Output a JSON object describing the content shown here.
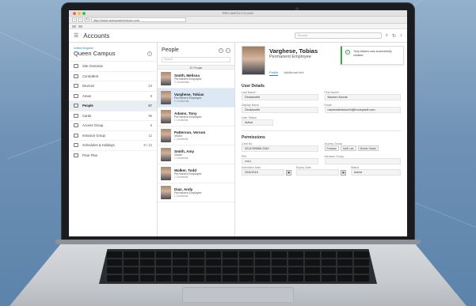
{
  "browser": {
    "window_title": "PRO-WATCH CLOUD",
    "url": "http://www.averywatchcloud.com",
    "back": "<",
    "forward": ">",
    "reload": "↻",
    "traffic": {
      "close": "#ff5f57",
      "minimize": "#febc2e",
      "maximize": "#28c840"
    }
  },
  "header": {
    "menu_icon": "hamburger-icon",
    "title": "Accounts",
    "search_placeholder": "Search",
    "search_icon": "search-icon",
    "refresh_icon": "refresh-icon",
    "notification_icon": "bell-icon"
  },
  "sidebar": {
    "site_label": "United Kingdom",
    "site_name": "Queen Campus",
    "items": [
      {
        "label": "Site Overview",
        "count": "",
        "icon": "grid-icon"
      },
      {
        "label": "Controllers",
        "count": "",
        "icon": "controller-icon"
      },
      {
        "label": "Devices",
        "count": "23",
        "icon": "device-icon"
      },
      {
        "label": "Areas",
        "count": "9",
        "icon": "area-icon"
      },
      {
        "label": "People",
        "count": "67",
        "icon": "people-icon",
        "active": true
      },
      {
        "label": "Cards",
        "count": "96",
        "icon": "card-icon"
      },
      {
        "label": "Access Group",
        "count": "8",
        "icon": "access-group-icon"
      },
      {
        "label": "Intrusion Group",
        "count": "12",
        "icon": "shield-icon"
      },
      {
        "label": "Schedules & Holidays",
        "count": "8 / 12",
        "icon": "calendar-icon"
      },
      {
        "label": "Floor Plan",
        "count": "",
        "icon": "floorplan-icon"
      }
    ]
  },
  "people": {
    "title": "People",
    "search_placeholder": "Search",
    "count_label": "67 People",
    "list": [
      {
        "name": "Smith, Melissa",
        "role": "Permanent Employee",
        "creds": "2 Credentials"
      },
      {
        "name": "Varghese, Tobias",
        "role": "Permanent Employee",
        "creds": "2 Credentials",
        "selected": true
      },
      {
        "name": "Adams, Tony",
        "role": "Permanent Employee",
        "creds": "1 Credential"
      },
      {
        "name": "Patterson, Vernon",
        "role": "Visitor",
        "creds": "1 Credential"
      },
      {
        "name": "Smith, Amy",
        "role": "Visitor",
        "creds": "1 Credential"
      },
      {
        "name": "Walker, Todd",
        "role": "Permanent Employee",
        "creds": "1 Credential"
      },
      {
        "name": "Diaz, Andy",
        "role": "Permanent Employee",
        "creds": "1 Credential"
      }
    ]
  },
  "detail": {
    "name": "Varghese, Tobias",
    "subtitle": "Permanent Employee",
    "toast": "Tony Adams was successfully created.",
    "tabs": [
      "Profile",
      "Additional Info"
    ],
    "user_details_title": "User Details",
    "last_name_label": "Last Name*",
    "last_name": "Dindukurthi",
    "first_name_label": "First Name*",
    "first_name": "Naveen Kumar",
    "display_name_label": "Display Name",
    "display_name": "Dindukurthi",
    "email_label": "Email",
    "email": "naveendindukurthi@honeywell.com",
    "user_status_label": "User Status",
    "user_status": "Active",
    "permissions_title": "Permissions",
    "card_no_label": "Card No",
    "card_no": "3214789556 2340",
    "access_group_label": "Access Group",
    "access_groups": [
      "Embase",
      "MoB Lab",
      "Mobile Studio"
    ],
    "pin_label": "PIN",
    "pin": "••••••",
    "intrusion_group_label": "Intrusion Group",
    "activation_date_label": "Activation Date",
    "activation_date": "22/8/2016",
    "expiry_date_label": "Expiry Date",
    "expiry_date": "",
    "status_label": "Status",
    "status": "Active"
  }
}
